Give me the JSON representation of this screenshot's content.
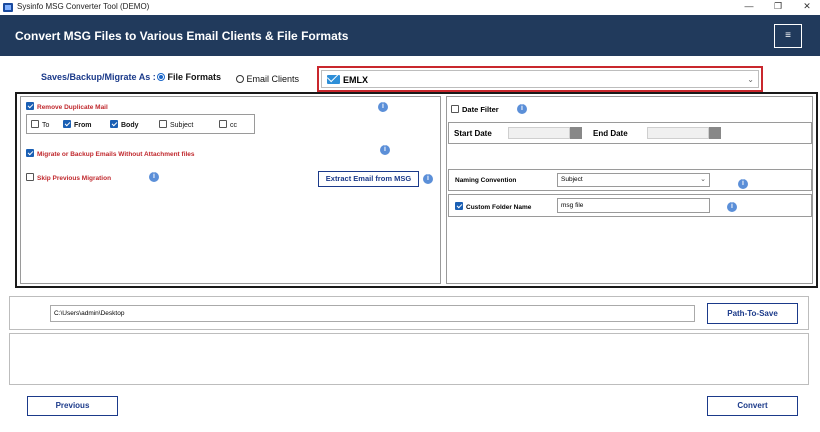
{
  "window": {
    "title": "Sysinfo MSG Converter Tool (DEMO)",
    "minimize_icon": "minimize-icon",
    "maximize_icon": "maximize-icon",
    "close_icon": "close-icon",
    "minimize_glyph": "—",
    "maximize_glyph": "❐",
    "close_glyph": "✕"
  },
  "header": {
    "title": "Convert MSG Files to Various Email Clients & File Formats",
    "menu_glyph": "≡"
  },
  "saves": {
    "label": "Saves/Backup/Migrate As :",
    "option_file": "File Formats",
    "option_email": "Email Clients",
    "selected_format": "EMLX",
    "chevron_glyph": "⌄"
  },
  "options": {
    "remove_duplicate": "Remove Duplicate Mail",
    "fields": {
      "to": "To",
      "from": "From",
      "body": "Body",
      "subject": "Subject",
      "cc": "cc"
    },
    "migrate_without_attachment": "Migrate or Backup Emails Without Attachment files",
    "skip_previous": "Skip Previous Migration",
    "extract_button": "Extract Email from MSG",
    "info_glyph": "i"
  },
  "right_panel": {
    "date_filter": "Date Filter",
    "start_date": "Start Date",
    "end_date": "End Date",
    "naming_convention_label": "Naming Convention",
    "naming_convention_value": "Subject",
    "custom_folder_label": "Custom Folder Name",
    "custom_folder_value": "msg file"
  },
  "path": {
    "value": "C:\\Users\\admin\\Desktop",
    "button": "Path-To-Save"
  },
  "footer": {
    "previous": "Previous",
    "convert": "Convert"
  },
  "colors": {
    "header_bg": "#213a5c",
    "accent_blue": "#1b3a8a",
    "option_red": "#c0282d",
    "highlight_border": "#c9272d"
  }
}
